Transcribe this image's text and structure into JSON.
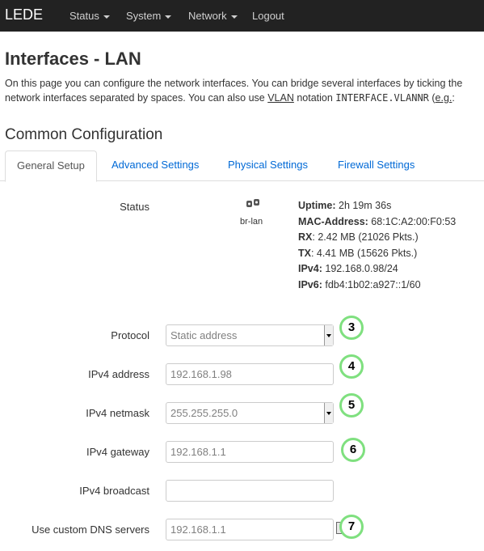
{
  "navbar": {
    "brand": "LEDE",
    "menu": [
      {
        "label": "Status"
      },
      {
        "label": "System"
      },
      {
        "label": "Network"
      },
      {
        "label": "Logout"
      }
    ]
  },
  "page": {
    "title": "Interfaces - LAN",
    "description_line1": "On this page you can configure the network interfaces. You can bridge several interfaces by ticking the",
    "description_line2_a": "network interfaces separated by spaces. You can also use ",
    "description_line2_vlan": "VLAN",
    "description_line2_b": " notation ",
    "description_line2_code": "INTERFACE.VLANNR",
    "description_line2_c": " (",
    "description_line2_eg": "e.g.",
    "description_line2_d": ": ",
    "section_title": "Common Configuration"
  },
  "tabs": [
    {
      "label": "General Setup",
      "active": true
    },
    {
      "label": "Advanced Settings",
      "active": false
    },
    {
      "label": "Physical Settings",
      "active": false
    },
    {
      "label": "Firewall Settings",
      "active": false
    }
  ],
  "status": {
    "label": "Status",
    "interface": "br-lan",
    "uptime_label": "Uptime:",
    "uptime": "2h 19m 36s",
    "mac_label": "MAC-Address:",
    "mac": "68:1C:A2:00:F0:53",
    "rx_label": "RX",
    "rx": ": 2.42 MB (21026 Pkts.)",
    "tx_label": "TX",
    "tx": ": 4.41 MB (15626 Pkts.)",
    "ipv4_label": "IPv4:",
    "ipv4": "192.168.0.98/24",
    "ipv6_label": "IPv6:",
    "ipv6": "fdb4:1b02:a927::1/60"
  },
  "fields": {
    "protocol": {
      "label": "Protocol",
      "value": "Static address",
      "badge": "3"
    },
    "ipv4_address": {
      "label": "IPv4 address",
      "value": "192.168.1.98",
      "badge": "4"
    },
    "ipv4_netmask": {
      "label": "IPv4 netmask",
      "value": "255.255.255.0",
      "badge": "5"
    },
    "ipv4_gateway": {
      "label": "IPv4 gateway",
      "value": "192.168.1.1",
      "badge": "6"
    },
    "ipv4_broadcast": {
      "label": "IPv4 broadcast",
      "value": ""
    },
    "dns": {
      "label": "Use custom DNS servers",
      "value": "192.168.1.1",
      "badge": "7"
    }
  },
  "colors": {
    "navbar": "#222222",
    "link": "#0069d6",
    "badge_ring": "#7fe07f"
  }
}
